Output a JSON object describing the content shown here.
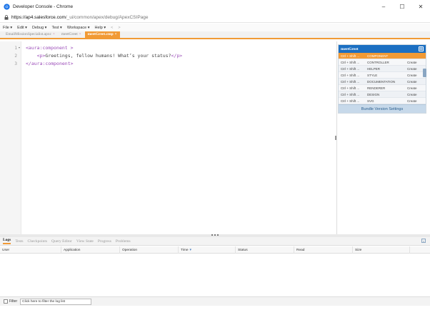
{
  "window": {
    "title": "Developer Console - Chrome",
    "controls": [
      "–",
      "☐",
      "✕"
    ]
  },
  "address": {
    "host": "https://ap4.salesforce.com",
    "path": "/_ui/common/apex/debug/ApexCSIPage"
  },
  "menu": {
    "items": [
      "File ▾",
      "Edit ▾",
      "Debug ▾",
      "Test ▾",
      "Workspace ▾",
      "Help ▾",
      "<",
      ">"
    ]
  },
  "file_tabs": [
    {
      "label": "EmailMissionSpecialist.apxc",
      "close": "×"
    },
    {
      "label": "meetGreet",
      "close": "×"
    },
    {
      "label": "meetGreet.cmp",
      "close": "×"
    }
  ],
  "editor": {
    "lines": [
      {
        "num": "1",
        "fold": "▾",
        "open": "<aura:component >",
        "rest": ""
      },
      {
        "num": "2",
        "fold": "",
        "indent": "    ",
        "open": "<p>",
        "text": "Greetings, fellow humans! What’s your status?",
        "close": "</p>"
      },
      {
        "num": "3",
        "fold": "",
        "open": "</aura:component>",
        "rest": ""
      }
    ]
  },
  "bundle": {
    "title": "meetGreet",
    "collapse": "⊟",
    "rows": [
      {
        "key": "Ctrl + Shift ...",
        "name": "COMPONENT",
        "action": ""
      },
      {
        "key": "Ctrl + Shift ...",
        "name": "CONTROLLER",
        "action": "Create"
      },
      {
        "key": "Ctrl + Shift ...",
        "name": "HELPER",
        "action": "Create"
      },
      {
        "key": "Ctrl + Shift ...",
        "name": "STYLE",
        "action": "Create"
      },
      {
        "key": "Ctrl + Shift ...",
        "name": "DOCUMENTATION",
        "action": "Create"
      },
      {
        "key": "Ctrl + Shift ...",
        "name": "RENDERER",
        "action": "Create"
      },
      {
        "key": "Ctrl + Shift ...",
        "name": "DESIGN",
        "action": "Create"
      },
      {
        "key": "Ctrl + Shift ...",
        "name": "SVG",
        "action": "Create"
      }
    ],
    "footer": "Bundle Version Settings"
  },
  "panel": {
    "tabs": [
      "Logs",
      "Tests",
      "Checkpoints",
      "Query Editor",
      "View State",
      "Progress",
      "Problems"
    ],
    "close": "×",
    "columns": [
      "User",
      "Application",
      "Operation",
      "Time",
      "Status",
      "Read",
      "Size"
    ],
    "sort_glyph": "▾",
    "filter_label": "Filter",
    "filter_placeholder": "Click here to filter the log list"
  },
  "colors": {
    "accent_orange": "#f19a35",
    "bundle_header_blue": "#1b6fc2",
    "tag_purple": "#9b4cb8"
  }
}
